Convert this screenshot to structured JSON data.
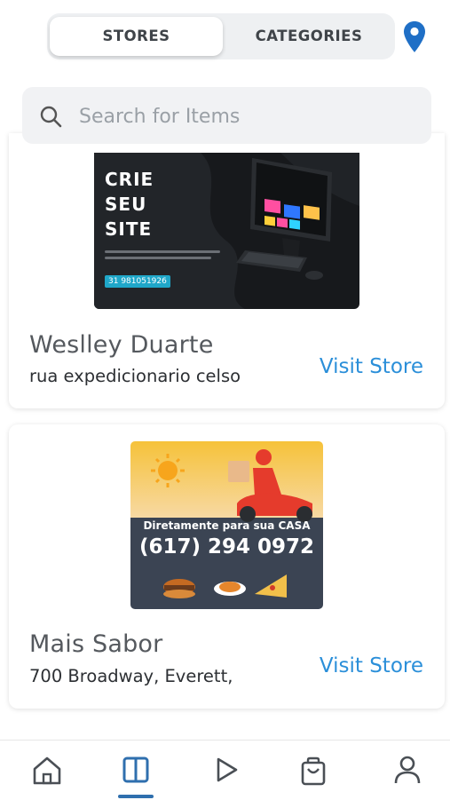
{
  "tabs": {
    "stores": "STORES",
    "categories": "CATEGORIES",
    "active": "stores"
  },
  "search": {
    "placeholder": "Search for Items",
    "value": ""
  },
  "stores": [
    {
      "name": "Weslley Duarte",
      "address": "rua expedicionario celso",
      "visit_label": "Visit Store",
      "banner": {
        "line1": "CRIE",
        "line2": "SEU",
        "line3": "SITE",
        "phone": "31 981051926"
      }
    },
    {
      "name": "Mais Sabor",
      "address": "700 Broadway, Everett,",
      "visit_label": "Visit Store",
      "banner": {
        "tagline": "Diretamente para sua CASA",
        "phone": "(617) 294 0972"
      }
    }
  ],
  "nav": {
    "items": [
      "home-icon",
      "stores-icon",
      "play-icon",
      "bag-icon",
      "profile-icon"
    ],
    "active": "stores-icon"
  },
  "colors": {
    "accent": "#2b8fd9",
    "nav_active": "#2f6fae",
    "pin": "#1f6fc6"
  }
}
